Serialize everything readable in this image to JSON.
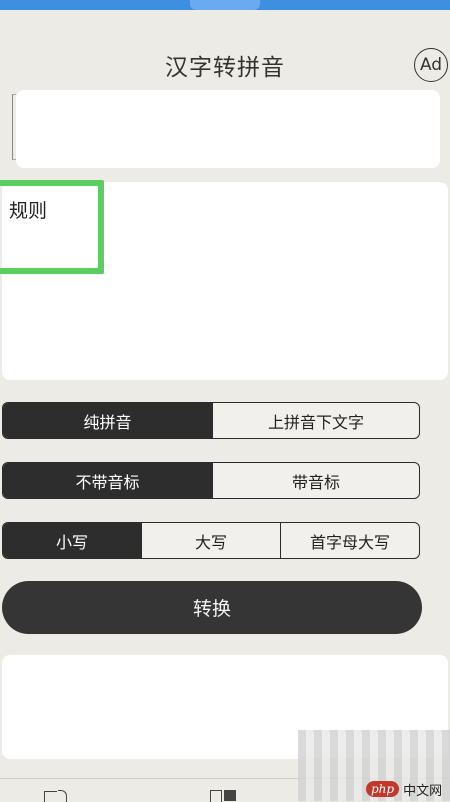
{
  "header": {
    "title": "汉字转拼音",
    "ad_label": "Ad"
  },
  "input": {
    "value": "",
    "placeholder": ""
  },
  "output": {
    "rule_label": "规则"
  },
  "options": {
    "pinyin_mode": {
      "items": [
        "纯拼音",
        "上拼音下文字"
      ],
      "selected": "纯拼音"
    },
    "tone_mode": {
      "items": [
        "不带音标",
        "带音标"
      ],
      "selected": "不带音标"
    },
    "case_mode": {
      "items": [
        "小写",
        "大写",
        "首字母大写"
      ],
      "selected": "小写"
    }
  },
  "convert_label": "转换",
  "tab_bar": {
    "icons": [
      "convert-tab-icon",
      "panel-tab-icon"
    ]
  },
  "watermark": {
    "logo": "php",
    "text": "中文网"
  },
  "colors": {
    "accent": "#2d2d2d",
    "highlight": "#5ccd60",
    "status_bar": "#3f8fe0"
  }
}
